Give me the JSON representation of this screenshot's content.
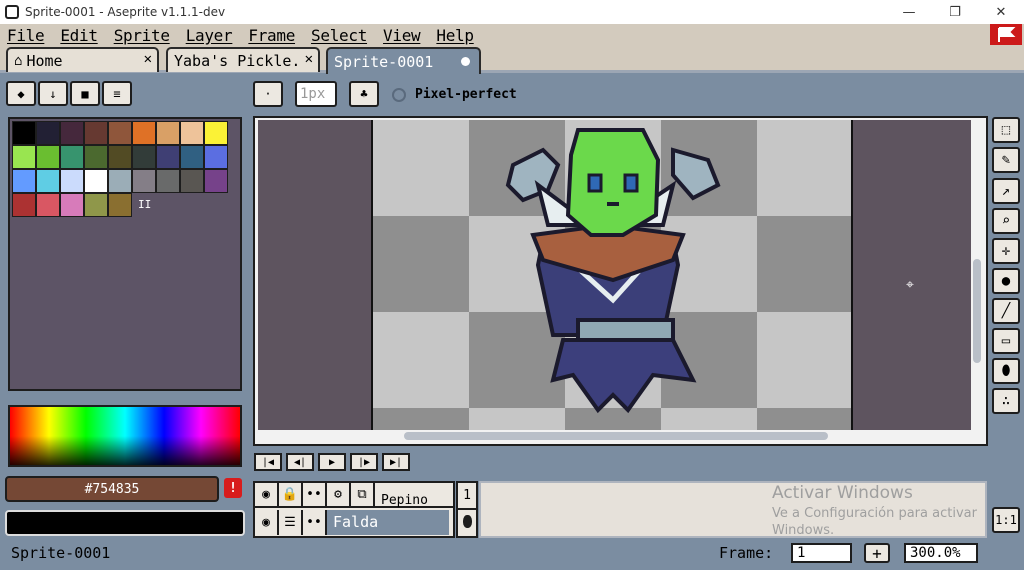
{
  "window": {
    "title": "Sprite-0001 - Aseprite v1.1.1-dev",
    "minimize_glyph": "—",
    "maximize_glyph": "❐",
    "close_glyph": "✕"
  },
  "menu": [
    "File",
    "Edit",
    "Sprite",
    "Layer",
    "Frame",
    "Select",
    "View",
    "Help"
  ],
  "tabs": [
    {
      "label": "Home",
      "icon": "home-icon",
      "closable": true
    },
    {
      "label": "Yaba's Pickle.jpg",
      "closable": true
    },
    {
      "label": "Sprite-0001",
      "active": true,
      "modified": true
    }
  ],
  "context_bar": {
    "brush_size": "1px",
    "pixel_perfect_label": "Pixel-perfect",
    "pixel_perfect_checked": false
  },
  "palette_toolbar": [
    "eraser-icon",
    "down-arrow-icon",
    "folder-icon",
    "menu-icon"
  ],
  "palette": {
    "rows": [
      [
        "#000000",
        "#222034",
        "#45283c",
        "#663931",
        "#8f563b",
        "#df7126",
        "#d9a066",
        "#eec39a",
        "#fbf236"
      ],
      [
        "#99e550",
        "#6abe30",
        "#37946e",
        "#4b692f",
        "#524b24",
        "#323c39",
        "#3f3f74",
        "#306082",
        "#5b6ee1"
      ],
      [
        "#639bff",
        "#5fcde4",
        "#cbdbfc",
        "#ffffff",
        "#9badb7",
        "#847e87",
        "#696a6a",
        "#595652",
        "#76428a"
      ],
      [
        "#ac3232",
        "#d95763",
        "#d77bba",
        "#8f974a",
        "#8a6f30"
      ]
    ],
    "overflow_marker": "II"
  },
  "colors": {
    "foreground": "#754835",
    "background": "#000000",
    "warning": "!"
  },
  "tools": [
    "marquee-icon",
    "pencil-icon",
    "eyedropper-icon",
    "zoom-icon",
    "move-icon",
    "paint-bucket-icon",
    "line-icon",
    "rectangle-icon",
    "blur-icon",
    "spray-icon"
  ],
  "playback": [
    "first-frame-icon",
    "previous-frame-icon",
    "play-icon",
    "next-frame-icon",
    "last-frame-icon"
  ],
  "layers": [
    {
      "name": "Pepino"
    },
    {
      "name": "Falda"
    }
  ],
  "frame_header": "1",
  "watermark": {
    "line1": "Activar Windows",
    "line2": "Ve a Configuración para activar",
    "line3": "Windows."
  },
  "zoom_button": "1:1",
  "status": {
    "sprite_name": "Sprite-0001",
    "frame_label": "Frame:",
    "frame_value": "1",
    "add_frame": "+",
    "zoom": "300.0%"
  }
}
